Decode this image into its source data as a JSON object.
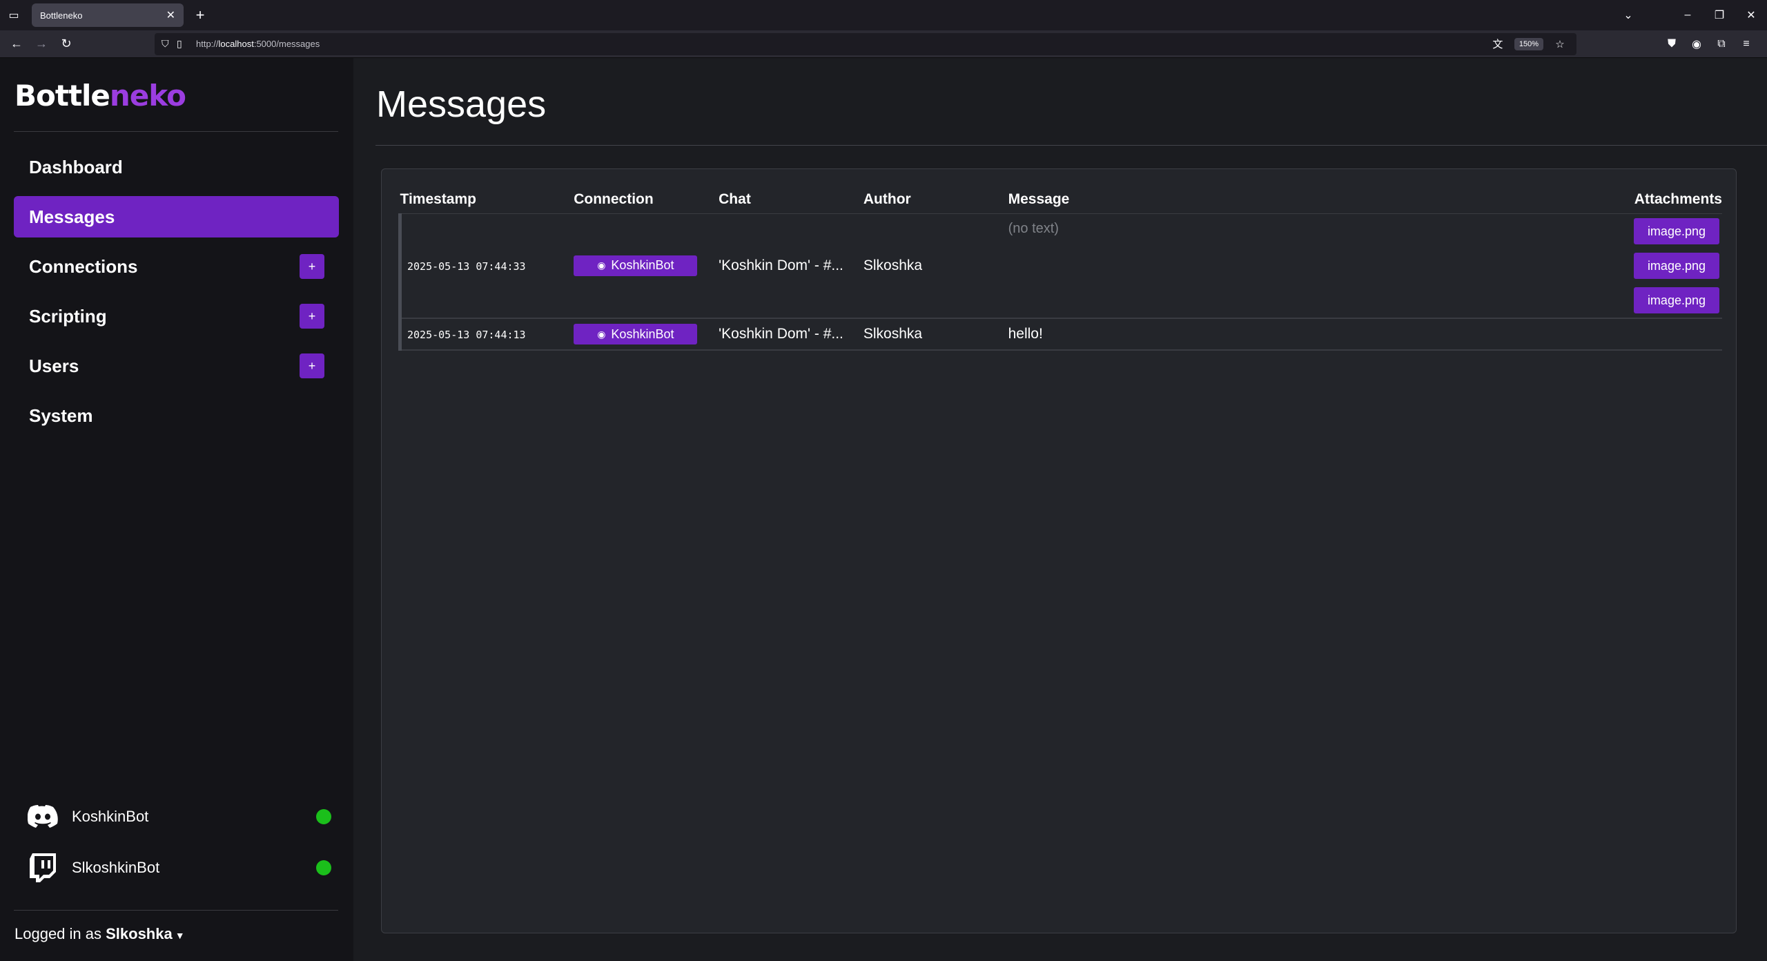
{
  "browser": {
    "tab_title": "Bottleneko",
    "url_prefix": "http://",
    "url_host": "localhost",
    "url_rest": ":5000/messages",
    "zoom": "150%"
  },
  "brand": {
    "part1": "Bottle",
    "part2": "neko"
  },
  "nav": {
    "dashboard": "Dashboard",
    "messages": "Messages",
    "connections": "Connections",
    "scripting": "Scripting",
    "users": "Users",
    "system": "System",
    "plus": "+"
  },
  "connections": [
    {
      "name": "KoshkinBot",
      "icon": "discord-icon",
      "status": "online"
    },
    {
      "name": "SlkoshkinBot",
      "icon": "twitch-icon",
      "status": "online"
    }
  ],
  "login": {
    "prefix": "Logged in as ",
    "user": "Slkoshka"
  },
  "page": {
    "title": "Messages"
  },
  "table": {
    "headers": [
      "Timestamp",
      "Connection",
      "Chat",
      "Author",
      "Message",
      "Attachments"
    ],
    "rows": [
      {
        "timestamp": "2025-05-13 07:44:33",
        "connection": "KoshkinBot",
        "chat": "'Koshkin Dom' - #...",
        "author": "Slkoshka",
        "message": "(no text)",
        "attachments": [
          "image.png",
          "image.png",
          "image.png"
        ]
      },
      {
        "timestamp": "2025-05-13 07:44:13",
        "connection": "KoshkinBot",
        "chat": "'Koshkin Dom' - #...",
        "author": "Slkoshka",
        "message": "hello!",
        "attachments": []
      }
    ]
  },
  "colors": {
    "accent": "#6f23c2",
    "brand_accent": "#9b3de0",
    "online": "#1bbf1b"
  }
}
